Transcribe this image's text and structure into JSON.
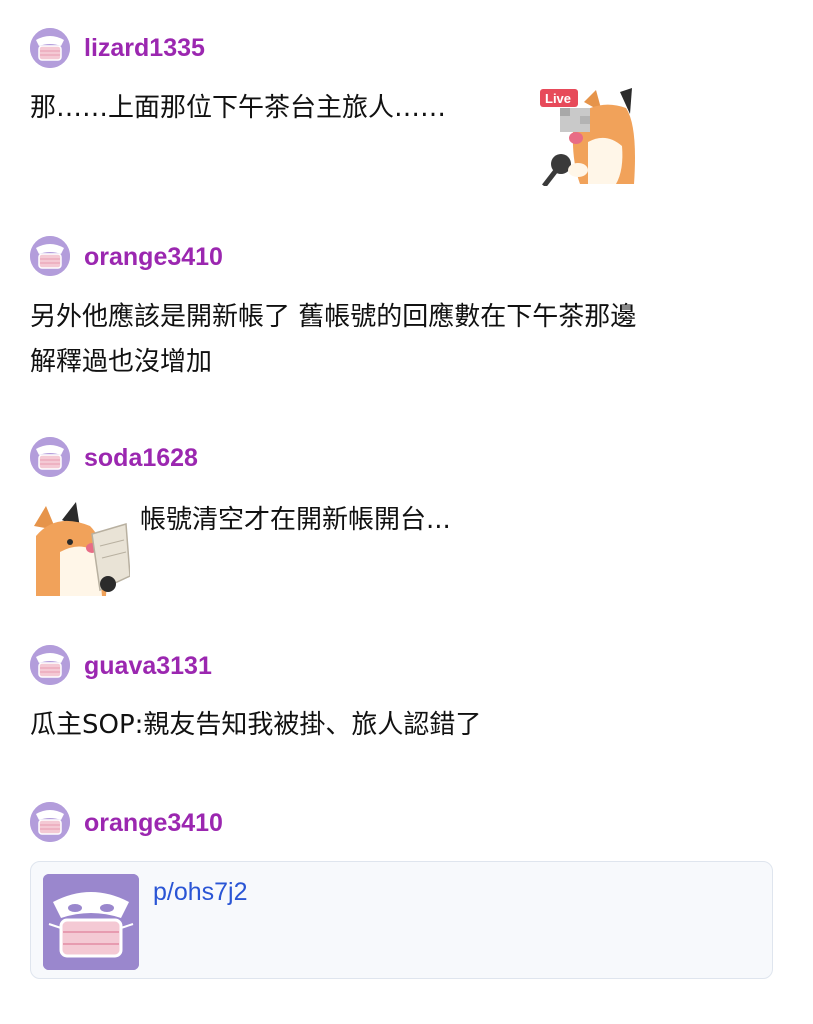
{
  "comments": [
    {
      "username": "lizard1335",
      "text": "那……上面那位下午茶台主旅人……",
      "sticker": "fox-reporter-live-sticker",
      "sticker_badge": "Live"
    },
    {
      "username": "orange3410",
      "text_lines": [
        "另外他應該是開新帳了 舊帳號的回應數在下午茶那邊",
        "解釋過也沒增加"
      ]
    },
    {
      "username": "soda1628",
      "text": "帳號清空才在開新帳開台...",
      "sticker": "fox-reading-paper-sticker"
    },
    {
      "username": "guava3131",
      "text": "瓜主SOP:親友告知我被掛、旅人認錯了"
    },
    {
      "username": "orange3410",
      "link_card": {
        "url_text": "p/ohs7j2",
        "thumbnail_icon": "masked-avatar-icon"
      }
    }
  ],
  "colors": {
    "username": "#9b27b0",
    "link": "#2a55d5",
    "avatar_bg": "#b39ddb",
    "mask": "#f4c9d4"
  }
}
